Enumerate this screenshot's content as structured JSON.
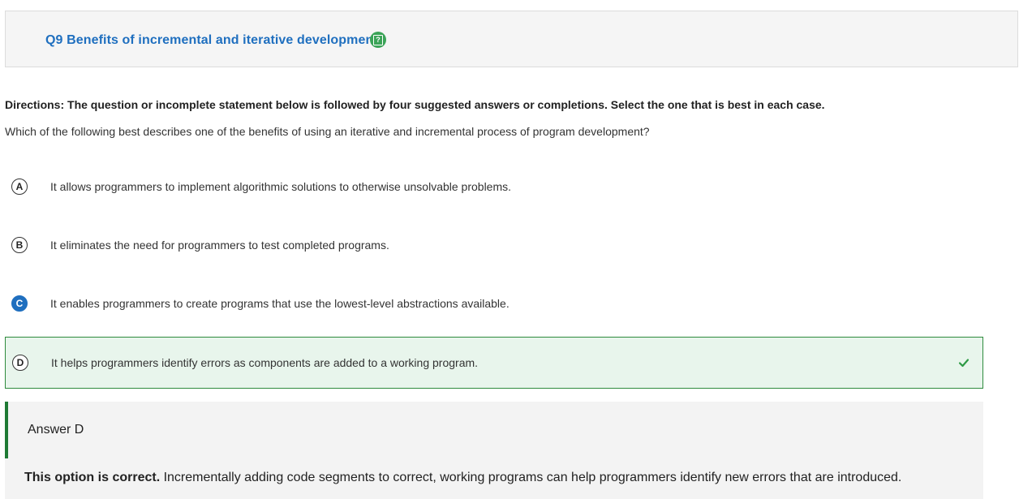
{
  "header": {
    "title": "Q9 Benefits of incremental and iterative development",
    "help_icon": "help-icon"
  },
  "directions": "Directions: The question or incomplete statement below is followed by four suggested answers or completions. Select the one that is best in each case.",
  "question": "Which of the following best describes one of the benefits of using an iterative and incremental process of program development?",
  "options": [
    {
      "letter": "A",
      "text": "It allows programmers to implement algorithmic solutions to otherwise unsolvable problems.",
      "selected": false,
      "correct": false
    },
    {
      "letter": "B",
      "text": "It eliminates the need for programmers to test completed programs.",
      "selected": false,
      "correct": false
    },
    {
      "letter": "C",
      "text": "It enables programmers to create programs that use the lowest-level abstractions available.",
      "selected": true,
      "correct": false
    },
    {
      "letter": "D",
      "text": "It helps programmers identify errors as components are added to a working program.",
      "selected": false,
      "correct": true
    }
  ],
  "answer": {
    "label": "Answer D",
    "explanation_bold": "This option is correct.",
    "explanation_text": " Incrementally adding code segments to correct, working programs can help programmers identify new errors that are introduced."
  },
  "colors": {
    "title_blue": "#1f6fbf",
    "correct_green": "#2e8b3d",
    "correct_bg": "#e8f5ec",
    "help_green": "#3aa357"
  }
}
